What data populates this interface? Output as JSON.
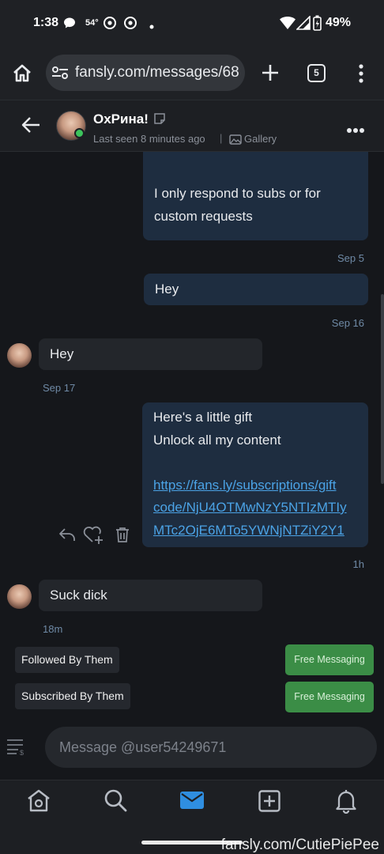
{
  "status_bar": {
    "time": "1:38",
    "temperature": "54°",
    "battery": "49%"
  },
  "browser": {
    "url": "fansly.com/messages/68",
    "tab_count": "5"
  },
  "chat_header": {
    "name": "ОхРина!",
    "last_seen": "Last seen 8 minutes ago",
    "separator": "|",
    "gallery_label": "Gallery"
  },
  "messages": [
    {
      "direction": "out",
      "lines": [
        "I only respond to subs or for",
        "custom requests"
      ],
      "time": "Sep 5"
    },
    {
      "direction": "out",
      "lines": [
        "Hey"
      ],
      "time": "Sep 16"
    },
    {
      "direction": "in",
      "lines": [
        "Hey"
      ],
      "time": "Sep 17"
    },
    {
      "direction": "out",
      "lines": [
        "Here's a little gift",
        "Unlock all my content"
      ],
      "link_lines": [
        "https://fans.ly/subscriptions/gift",
        "code/NjU4OTMwNzY5NTIzMTIy",
        "MTc2OjE6MTo5YWNjNTZiY2Y1"
      ],
      "time": "1h"
    },
    {
      "direction": "in",
      "lines": [
        "Suck dick"
      ],
      "time": "18m"
    }
  ],
  "badges": {
    "followed": "Followed By Them",
    "subscribed": "Subscribed By Them",
    "free_messaging_1": "Free Messaging",
    "free_messaging_2": "Free Messaging"
  },
  "composer": {
    "placeholder": "Message @user54249671"
  },
  "nav": [
    "home-icon",
    "search-icon",
    "messages-icon",
    "create-post-icon",
    "notifications-icon"
  ],
  "watermark": "fansly.com/CutiePiePee",
  "colors": {
    "accent": "#2f8ee0",
    "outgoing_bubble": "#1e2d40",
    "incoming_bubble": "#23262b",
    "free_button": "#3b8d46",
    "online": "#3cc45c"
  }
}
